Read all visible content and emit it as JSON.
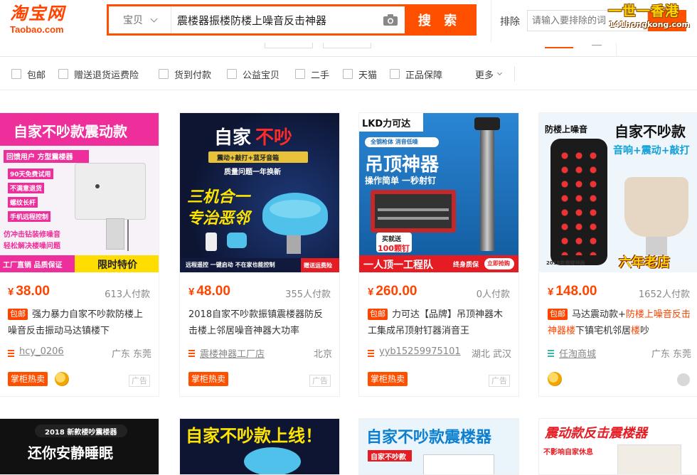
{
  "header": {
    "logo_cn": "淘宝网",
    "logo_en": "Taobao.com",
    "search_type": "宝贝",
    "search_query": "震楼器振楼防楼上噪音反击神器",
    "search_button": "搜 索",
    "exclude_label": "排除",
    "exclude_placeholder": "请输入要排除的词",
    "watermark_cn": "一世一香港",
    "watermark_en": "141hongkong.com"
  },
  "filters": {
    "items": [
      "包邮",
      "赠送退货运费险",
      "货到付款",
      "公益宝贝",
      "二手",
      "天猫",
      "正品保障"
    ],
    "more": "更多"
  },
  "colors": {
    "accent": "#ff5000",
    "price": "#ff4400"
  },
  "products": [
    {
      "price": "38.00",
      "currency": "¥",
      "sales": "613人付款",
      "badge": "包邮",
      "title": "强力暴力自家不吵款防楼上噪音反击振动马达镇楼下",
      "shop": "hcy_0206",
      "location": "广东 东莞",
      "tag": "掌柜热卖",
      "ad": "广告",
      "img": {
        "headline": "自家不吵款震动款",
        "line1": "回馈用户 方型震楼器",
        "bullets": [
          "90天免费试用",
          "不满意退货",
          "螺纹长杆",
          "手机远程控制"
        ],
        "line2": "仿冲击钻装修噪音",
        "line3": "轻松解决楼噪问题",
        "footer_left": "工厂直销 品质保证",
        "footer_right": "限时特价"
      }
    },
    {
      "price": "48.00",
      "currency": "¥",
      "sales": "355人付款",
      "badge": "",
      "title": "2018自家不吵款振镇震楼器防反击楼上邻居噪音神器大功率",
      "shop": "震楼神器工厂店",
      "location": "北京",
      "tag": "掌柜热卖",
      "ad": "广告",
      "img": {
        "headline_a": "自家",
        "headline_b": "不吵",
        "sub": "震动+敲打+蓝牙音箱",
        "sub2": "质量问题一年换新",
        "slogan1": "三机合一",
        "slogan2": "专治恶邻",
        "footer": "远程遥控 一键启动 不在家也能控制",
        "corner": "赠送运费险"
      }
    },
    {
      "price": "260.00",
      "currency": "¥",
      "sales": "0人付款",
      "badge": "包邮",
      "title": "力可达【品牌】吊顶神器木工集成吊顶射钉器消音王",
      "shop": "yyb15259975101",
      "location": "湖北 武汉",
      "tag": "掌柜热卖",
      "ad": "广告",
      "img": {
        "brand": "LKD力可达",
        "sub": "全钢枪体 消音低噪",
        "headline": "吊顶神器",
        "line": "操作简单 一秒射钉",
        "gift1": "买就送",
        "gift2": "100颗钉",
        "footer": "一人顶一工程队",
        "footer2": "终身质保",
        "footer3": "立即抢购"
      }
    },
    {
      "price": "148.00",
      "currency": "¥",
      "sales": "1652人付款",
      "badge": "包邮",
      "title_pre": "马达震动款+",
      "title_hl1": "防楼上噪音反击神器楼",
      "title_mid": "下镇宅机邻居",
      "title_hl2": "楼",
      "title_post": "吵",
      "shop": "任淘商城",
      "location": "广东 东莞",
      "img": {
        "top_left": "防楼上噪音",
        "headline": "自家不吵款",
        "sub": "音响+震动+敲打",
        "footer": "2018款震楼神器",
        "slogan": "六年老店"
      }
    }
  ],
  "row2": [
    {
      "label1": "2018 新款楼吵震楼器",
      "label2": "还你安静睡眠"
    },
    {
      "label1": "自家不吵款上线！"
    },
    {
      "label1": "自家不吵款震楼器",
      "label2": "自家不吵款"
    },
    {
      "label1": "震动款反击震楼器",
      "label2": "不影响自家休息"
    }
  ]
}
